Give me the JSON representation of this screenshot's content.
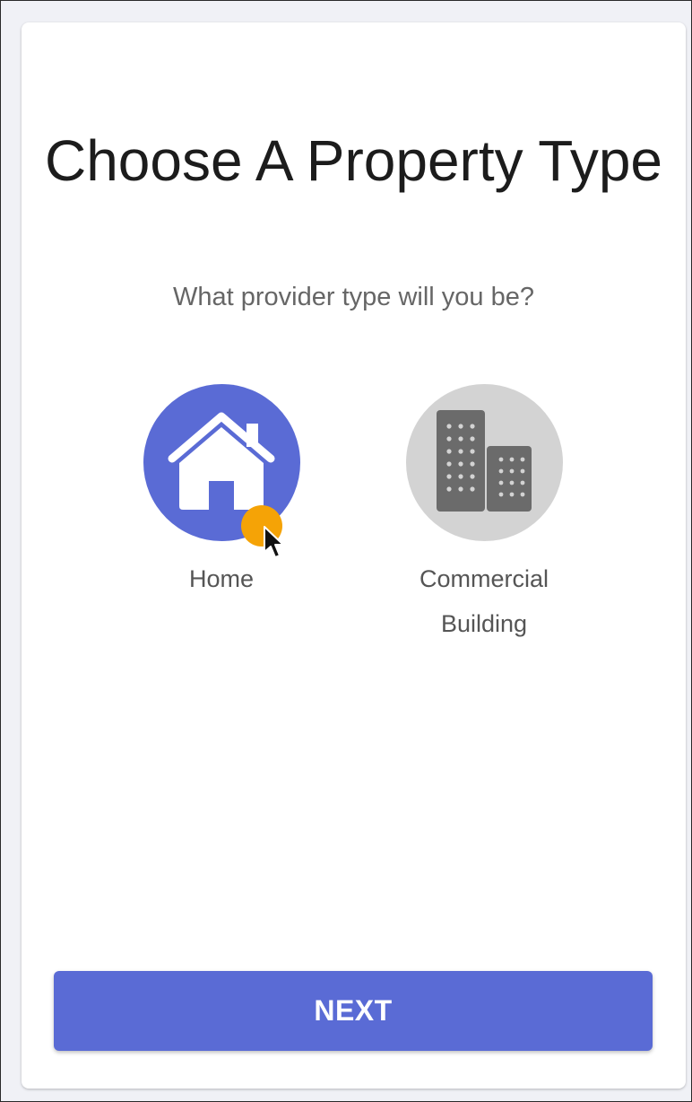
{
  "page": {
    "title": "Choose A Property Type",
    "subtitle": "What provider type will you be?"
  },
  "options": [
    {
      "label": "Home",
      "icon": "house-icon",
      "selected": true
    },
    {
      "label": "Commercial Building",
      "icon": "building-icon",
      "selected": false
    }
  ],
  "actions": {
    "next_label": "NEXT"
  },
  "colors": {
    "accent": "#5a6bd5",
    "unselected_circle": "#d3d3d3",
    "unselected_icon": "#6b6b6b",
    "cursor_highlight": "#f5a306"
  }
}
